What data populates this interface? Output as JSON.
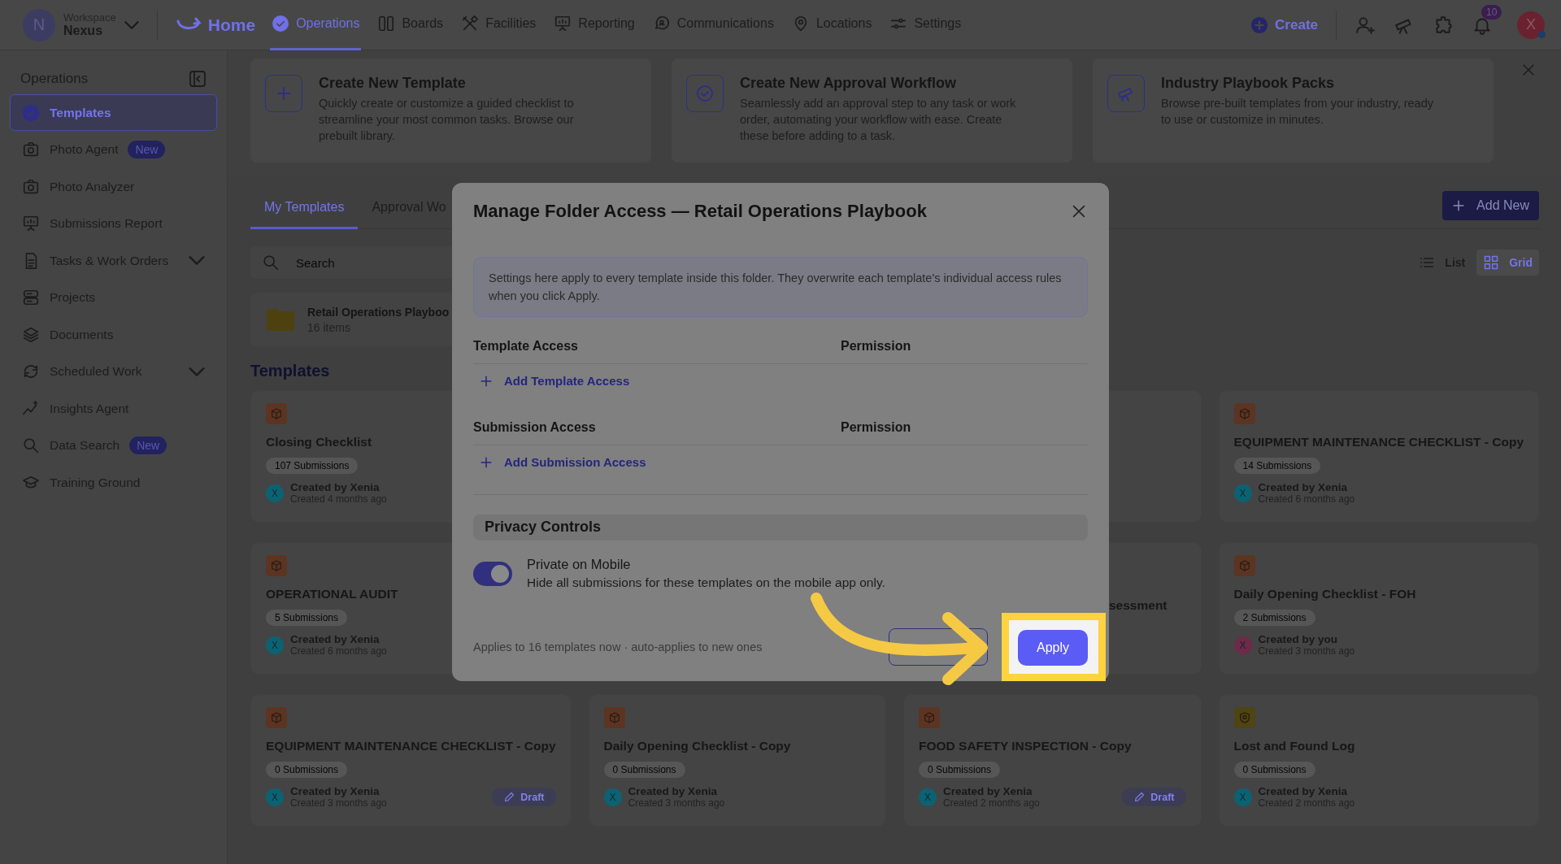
{
  "topbar": {
    "workspace_label": "Workspace",
    "workspace_name": "Nexus",
    "avatar_letter": "N",
    "brand": "Home",
    "nav": [
      {
        "label": "Operations",
        "selected": true
      },
      {
        "label": "Boards",
        "selected": false
      },
      {
        "label": "Facilities",
        "selected": false
      },
      {
        "label": "Reporting",
        "selected": false
      },
      {
        "label": "Communications",
        "selected": false
      },
      {
        "label": "Locations",
        "selected": false
      },
      {
        "label": "Settings",
        "selected": false
      }
    ],
    "create": "Create",
    "notifications": "10",
    "user_letter": "X"
  },
  "sidebar": {
    "title": "Operations",
    "items": [
      {
        "label": "Templates",
        "selected": true,
        "expandable": false
      },
      {
        "label": "Photo Agent",
        "selected": false,
        "expandable": false,
        "badge": "New"
      },
      {
        "label": "Photo Analyzer",
        "selected": false,
        "expandable": false
      },
      {
        "label": "Submissions Report",
        "selected": false,
        "expandable": false
      },
      {
        "label": "Tasks & Work Orders",
        "selected": false,
        "expandable": true
      },
      {
        "label": "Projects",
        "selected": false,
        "expandable": false
      },
      {
        "label": "Documents",
        "selected": false,
        "expandable": false
      },
      {
        "label": "Scheduled Work",
        "selected": false,
        "expandable": true
      },
      {
        "label": "Insights Agent",
        "selected": false,
        "expandable": false
      },
      {
        "label": "Data Search",
        "selected": false,
        "expandable": false,
        "badge": "New"
      },
      {
        "label": "Training Ground",
        "selected": false,
        "expandable": false
      }
    ]
  },
  "banners": [
    {
      "title": "Create New Template",
      "text": "Quickly create or customize a guided checklist to streamline your most common tasks. Browse our prebuilt library."
    },
    {
      "title": "Create New Approval Workflow",
      "text": "Seamlessly add an approval step to any task or work order, automating your workflow with ease. Create these before adding to a task."
    },
    {
      "title": "Industry Playbook Packs",
      "text": "Browse pre-built templates from your industry, ready to use or customize in minutes."
    }
  ],
  "tabs": [
    {
      "label": "My Templates",
      "selected": true
    },
    {
      "label": "Approval Wo",
      "selected": false
    }
  ],
  "add_new": "Add New",
  "search": {
    "placeholder": "Search"
  },
  "views": [
    {
      "label": "List",
      "selected": false
    },
    {
      "label": "Grid",
      "selected": true
    }
  ],
  "folder": {
    "name": "Retail Operations Playboo",
    "count": "16 items"
  },
  "templates_heading": "Templates",
  "templates": [
    {
      "kind": "checklist",
      "title": "Closing Checklist",
      "submissions": "107 Submissions",
      "creator": "Created by Xenia",
      "created": "Created 4 months ago",
      "avatar": "X",
      "color": "#0c6273",
      "draft": false
    },
    {
      "kind": "covered"
    },
    {
      "kind": "covered"
    },
    {
      "kind": "checklist",
      "title": "EQUIPMENT MAINTENANCE CHECKLIST - Copy",
      "submissions": "14 Submissions",
      "creator": "Created by Xenia",
      "created": "Created 6 months ago",
      "avatar": "X",
      "color": "#0c6273",
      "draft": false
    },
    {
      "kind": "checklist",
      "title": "OPERATIONAL AUDIT",
      "submissions": "5 Submissions",
      "creator": "Created by Xenia",
      "created": "Created 6 months ago",
      "avatar": "X",
      "color": "#0c6273",
      "draft": false
    },
    {
      "kind": "covered"
    },
    {
      "kind": "covered",
      "title": "sessment"
    },
    {
      "kind": "checklist",
      "title": "Daily Opening Checklist - FOH",
      "submissions": "2 Submissions",
      "creator": "Created by you",
      "created": "Created 3 months ago",
      "avatar": "X",
      "color": "#6e2a48",
      "draft": false
    },
    {
      "kind": "checklist",
      "title": "EQUIPMENT MAINTENANCE CHECKLIST - Copy",
      "submissions": "0 Submissions",
      "creator": "Created by Xenia",
      "created": "Created 3 months ago",
      "avatar": "X",
      "color": "#0c6273",
      "draft": true,
      "draft_label": "Draft"
    },
    {
      "kind": "checklist",
      "title": "Daily Opening Checklist - Copy",
      "submissions": "0 Submissions",
      "creator": "Created by Xenia",
      "created": "Created 3 months ago",
      "avatar": "X",
      "color": "#0c6273",
      "draft": false
    },
    {
      "kind": "checklist",
      "title": "FOOD SAFETY INSPECTION - Copy",
      "submissions": "0 Submissions",
      "creator": "Created by Xenia",
      "created": "Created 2 months ago",
      "avatar": "X",
      "color": "#0c6273",
      "draft": true,
      "draft_label": "Draft"
    },
    {
      "kind": "log",
      "title": "Lost and Found Log",
      "submissions": "0 Submissions",
      "creator": "Created by Xenia",
      "created": "Created 2 months ago",
      "avatar": "X",
      "color": "#0c6273",
      "draft": false
    }
  ],
  "modal": {
    "title": "Manage Folder Access — Retail Operations Playbook",
    "info": "Settings here apply to every template inside this folder. They overwrite each template's individual access rules when you click Apply.",
    "sections": [
      {
        "heading": "Template Access",
        "permission": "Permission",
        "add": "Add Template Access"
      },
      {
        "heading": "Submission Access",
        "permission": "Permission",
        "add": "Add Submission Access"
      }
    ],
    "privacy_heading": "Privacy Controls",
    "toggle": {
      "label": "Private on Mobile",
      "description": "Hide all submissions for these templates on the mobile app only.",
      "on": true
    },
    "footer_note": "Applies to 16 templates now · auto-applies to new ones",
    "apply": "Apply"
  }
}
